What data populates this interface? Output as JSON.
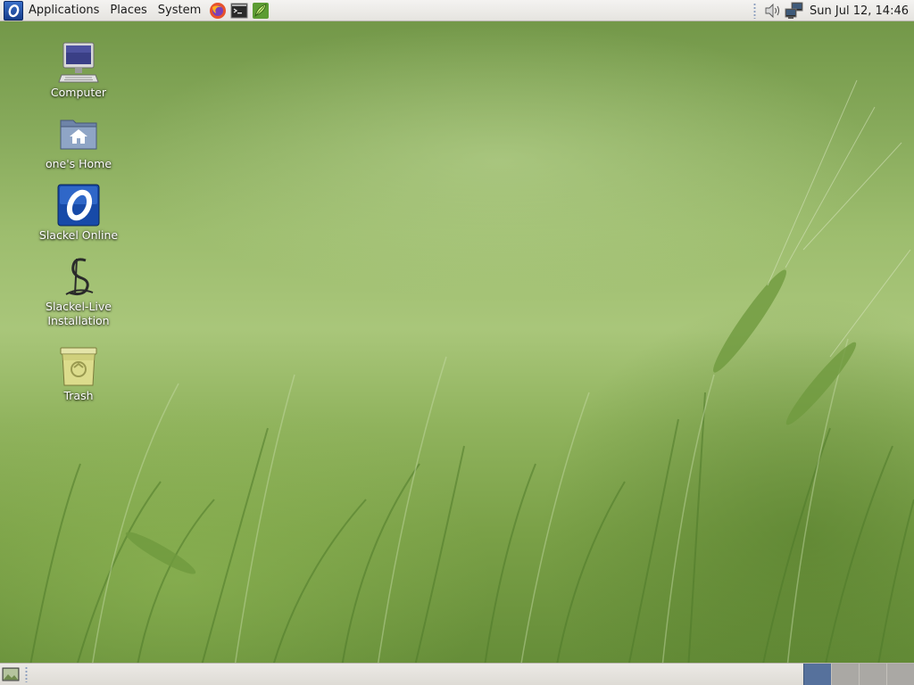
{
  "top_panel": {
    "menus": [
      "Applications",
      "Places",
      "System"
    ],
    "launchers": [
      "firefox-icon",
      "terminal-icon",
      "feather-icon"
    ],
    "clock": "Sun Jul 12, 14:46",
    "tray_icons": [
      "volume-icon",
      "network-icon"
    ]
  },
  "desktop": {
    "icons": [
      {
        "label": "Computer",
        "icon": "computer-icon"
      },
      {
        "label": "one's Home",
        "icon": "home-folder-icon"
      },
      {
        "label": "Slackel Online",
        "icon": "slackel-logo-icon"
      },
      {
        "label": "Slackel-Live\nInstallation",
        "icon": "slackel-installer-icon"
      },
      {
        "label": "Trash",
        "icon": "trash-icon"
      }
    ]
  },
  "bottom_panel": {
    "workspaces": 4,
    "active_workspace": 1
  },
  "colors": {
    "panel_bg": "#e6e4e0",
    "workspace_active": "#56719c",
    "workspace_inactive": "#aaa8a4",
    "wallpaper_green": "#9dbd6e"
  }
}
